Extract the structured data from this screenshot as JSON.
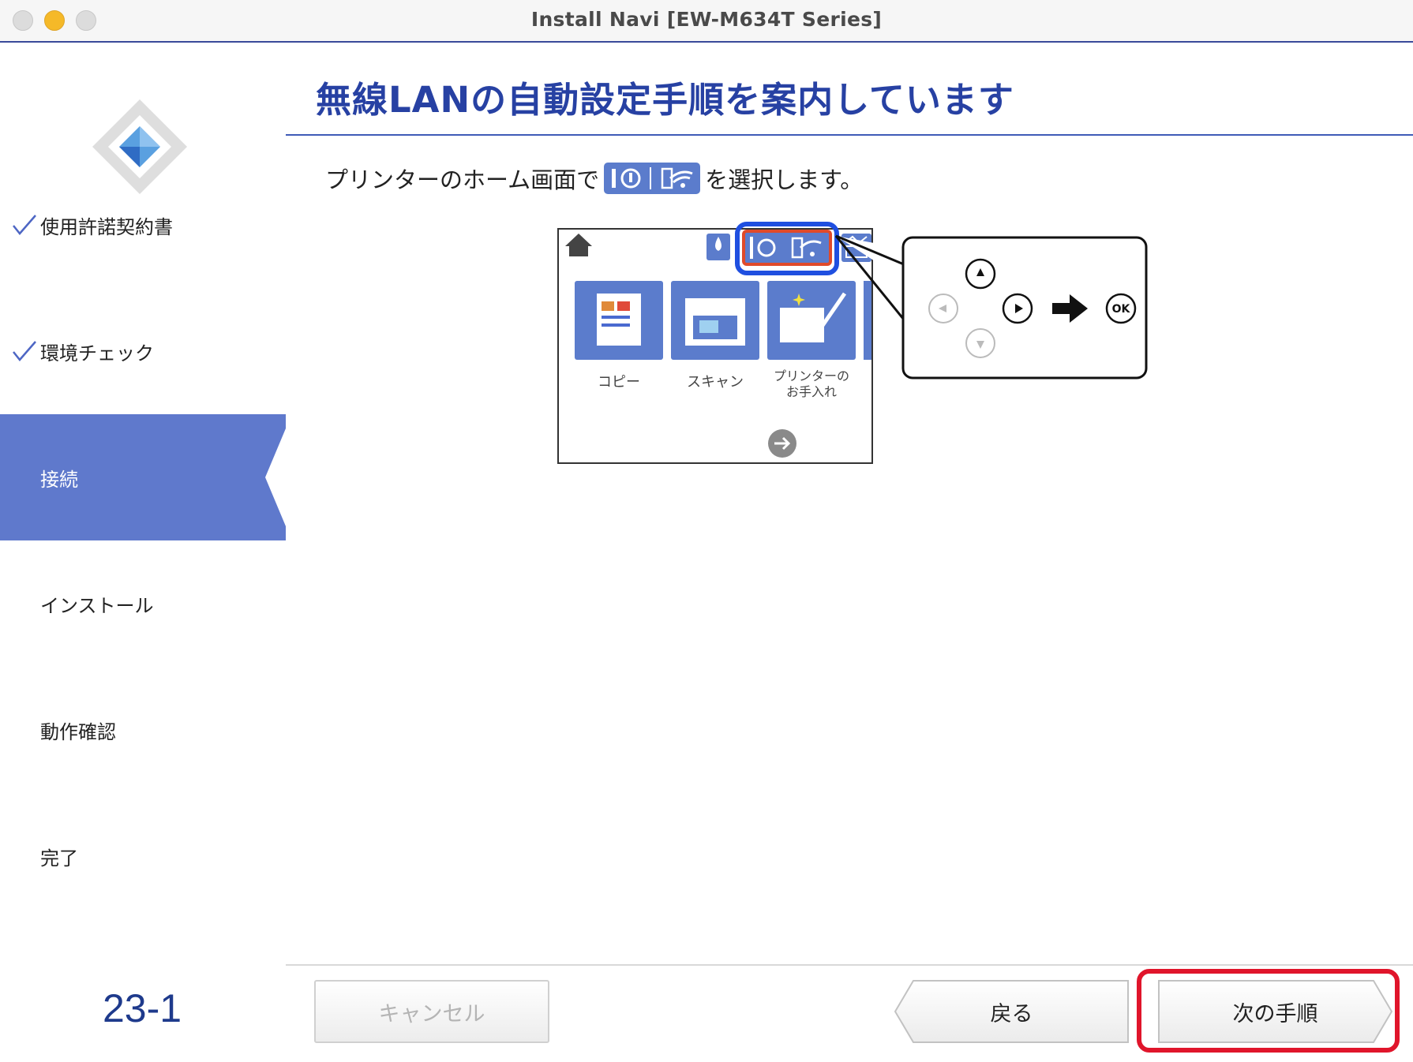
{
  "window": {
    "title": "Install Navi [EW-M634T Series]"
  },
  "sidebar": {
    "steps": [
      {
        "label": "使用許諾契約書",
        "done": true
      },
      {
        "label": "環境チェック",
        "done": true
      },
      {
        "label": "接続",
        "active": true
      },
      {
        "label": "インストール"
      },
      {
        "label": "動作確認"
      },
      {
        "label": "完了"
      }
    ],
    "page_number": "23-1"
  },
  "main": {
    "title": "無線LANの自動設定手順を案内しています",
    "instruction_before": "プリンターのホーム画面で",
    "instruction_after": "を選択します。",
    "panel": {
      "tiles": [
        "コピー",
        "スキャン",
        "プリンターの",
        "お手入れ"
      ]
    },
    "callout": {
      "ok_label": "OK"
    }
  },
  "buttons": {
    "cancel": "キャンセル",
    "back": "戻る",
    "next": "次の手順"
  },
  "colors": {
    "accent": "#5f79cc",
    "title": "#2741a3",
    "highlight": "#e0152b"
  }
}
